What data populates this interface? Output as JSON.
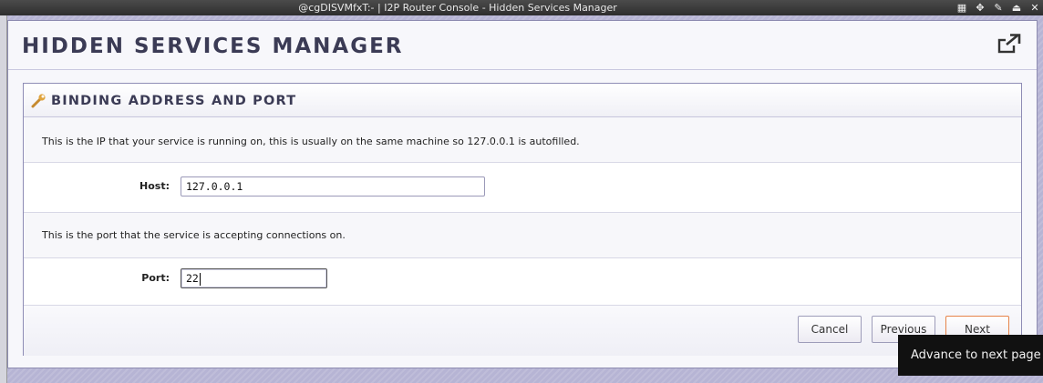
{
  "window": {
    "title": "@cgDISVMfxT:- | I2P Router Console - Hidden Services Manager",
    "controls": [
      {
        "name": "grid-icon",
        "glyph": "▦"
      },
      {
        "name": "move-icon",
        "glyph": "✥"
      },
      {
        "name": "pin-icon",
        "glyph": "✎"
      },
      {
        "name": "shade-icon",
        "glyph": "⏏"
      },
      {
        "name": "close-icon",
        "glyph": "✕"
      }
    ]
  },
  "page": {
    "title": "HIDDEN SERVICES MANAGER",
    "external_link_icon": "external-link-icon"
  },
  "panel": {
    "title": "BINDING ADDRESS AND PORT",
    "icon": "wrench-icon",
    "host_description": "This is the IP that your service is running on, this is usually on the same machine so 127.0.0.1 is autofilled.",
    "host_label": "Host:",
    "host_value": "127.0.0.1",
    "port_description": "This is the port that the service is accepting connections on.",
    "port_label": "Port:",
    "port_value": "22"
  },
  "buttons": {
    "cancel": "Cancel",
    "previous": "Previous",
    "next": "Next"
  },
  "tooltip": "Advance to next page",
  "colors": {
    "accent": "#e6844a",
    "title_text": "#3b3b55",
    "border": "#8e8cb5"
  }
}
